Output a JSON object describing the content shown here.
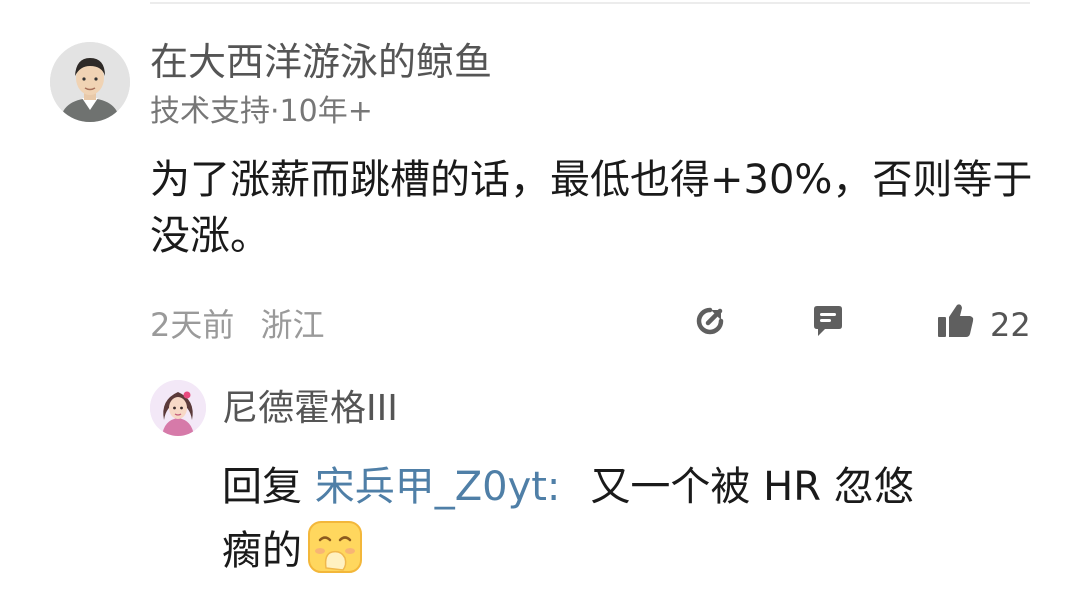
{
  "comment": {
    "username": "在大西洋游泳的鲸鱼",
    "meta": "技术支持·10年+",
    "text": "为了涨薪而跳槽的话，最低也得+30%，否则等于没涨。",
    "time": "2天前",
    "location": "浙江",
    "like_count": "22",
    "icons": [
      "share-icon",
      "reply-icon",
      "thumbs-up-icon"
    ]
  },
  "reply": {
    "username": "尼德霍格III",
    "prefix": "回复",
    "target": "宋兵甲_Z0yt:",
    "text_line1": "又一个被 HR 忽悠",
    "text_line2": "瘸的",
    "emoji": "face-with-hand-over-mouth-emoji"
  },
  "colors": {
    "link": "#4f7fa7",
    "text": "#1a1a1a",
    "secondary": "#777777",
    "icon": "#5f5f5f"
  }
}
